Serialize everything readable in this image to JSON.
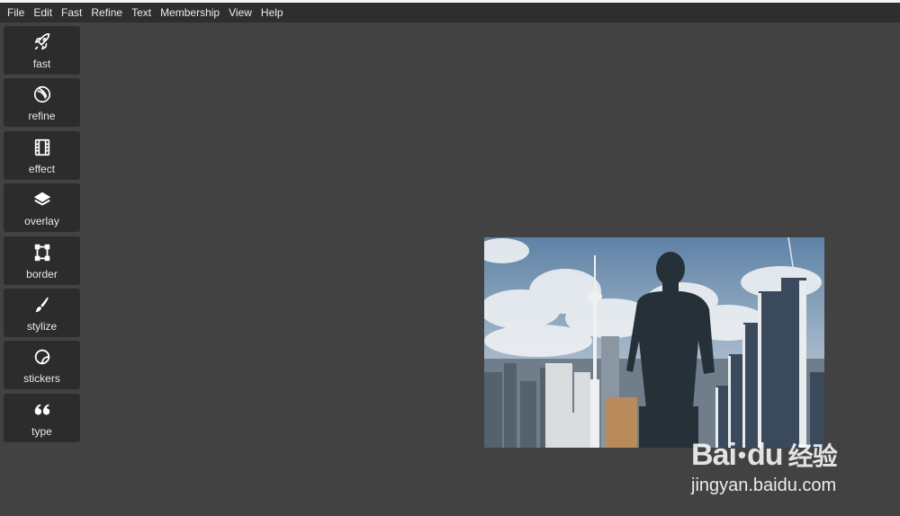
{
  "menu": [
    "File",
    "Edit",
    "Fast",
    "Refine",
    "Text",
    "Membership",
    "View",
    "Help"
  ],
  "tools": [
    {
      "id": "fast",
      "label": "fast",
      "icon": "rocket-icon"
    },
    {
      "id": "refine",
      "label": "refine",
      "icon": "refine-icon"
    },
    {
      "id": "effect",
      "label": "effect",
      "icon": "film-icon"
    },
    {
      "id": "overlay",
      "label": "overlay",
      "icon": "layers-icon"
    },
    {
      "id": "border",
      "label": "border",
      "icon": "border-frame-icon"
    },
    {
      "id": "stylize",
      "label": "stylize",
      "icon": "brush-icon"
    },
    {
      "id": "stickers",
      "label": "stickers",
      "icon": "sticker-icon"
    },
    {
      "id": "type",
      "label": "type",
      "icon": "quote-icon"
    }
  ],
  "watermark": {
    "logo_text": "Bai",
    "logo_text2": "du",
    "logo_cn": "经验",
    "url": "jingyan.baidu.com"
  },
  "colors": {
    "workspace": "#424242",
    "menubar": "#2e2e2e",
    "tool_bg": "#2c2c2c"
  }
}
